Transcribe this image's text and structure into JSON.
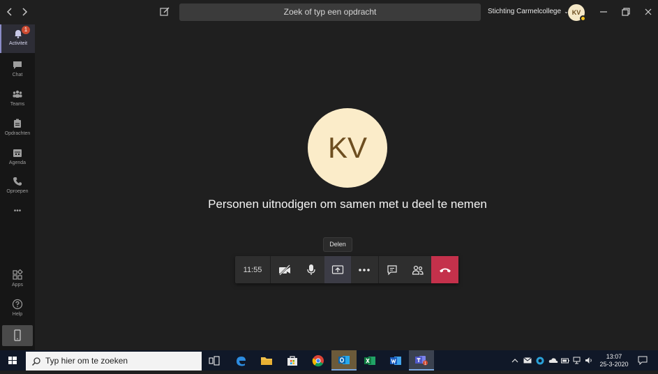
{
  "titlebar": {
    "search_placeholder": "Zoek of typ een opdracht",
    "org_name": "Stichting Carmelcollege",
    "avatar_initials": "KV"
  },
  "rail": {
    "items": [
      {
        "label": "Activiteit",
        "icon": "bell-icon",
        "badge": "1"
      },
      {
        "label": "Chat",
        "icon": "chat-icon"
      },
      {
        "label": "Teams",
        "icon": "teams-icon"
      },
      {
        "label": "Opdrachten",
        "icon": "assignments-icon"
      },
      {
        "label": "Agenda",
        "icon": "calendar-icon"
      },
      {
        "label": "Oproepen",
        "icon": "phone-icon"
      }
    ],
    "more_label": "•••",
    "apps_label": "Apps",
    "help_label": "Help"
  },
  "stage": {
    "avatar_initials": "KV",
    "invite_text": "Personen uitnodigen om samen met u deel te nemen",
    "tooltip": "Delen"
  },
  "controls": {
    "elapsed": "11:55",
    "hangup_color": "#c4314b"
  },
  "taskbar": {
    "search_placeholder": "Typ hier om te zoeken",
    "time": "13:07",
    "date": "25-3-2020"
  }
}
